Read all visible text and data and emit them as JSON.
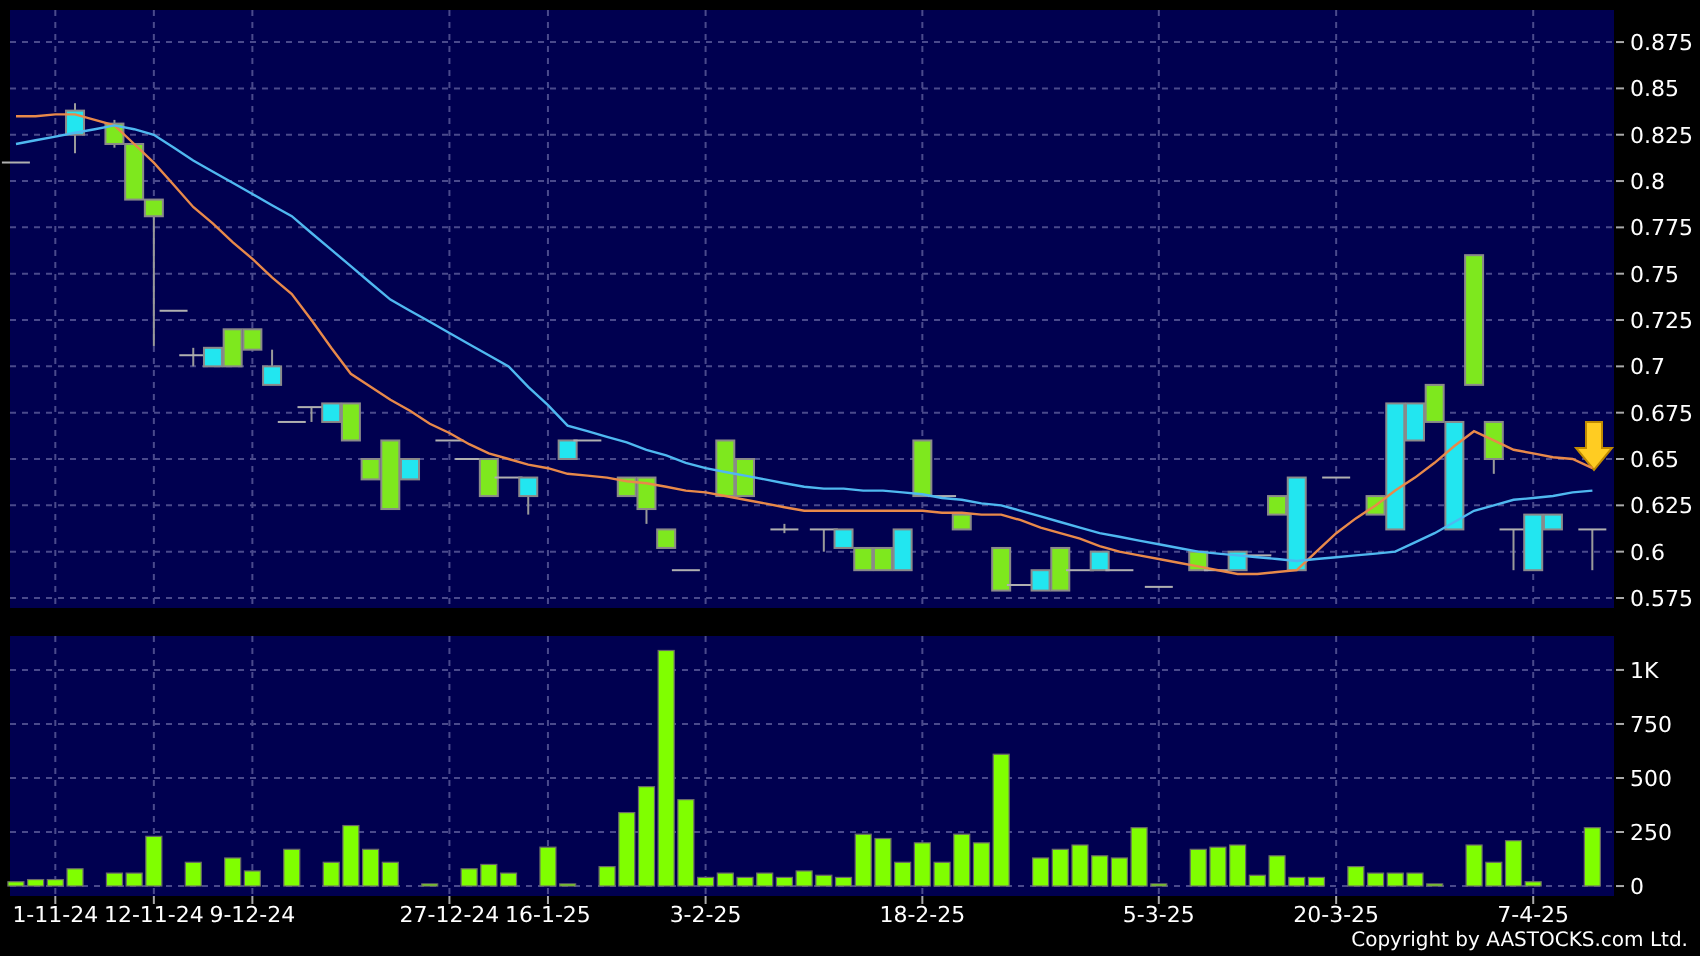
{
  "price_chart": {
    "chart_data": {
      "type": "line",
      "grid": true,
      "ylim": [
        0.5696,
        0.8923
      ],
      "yticks": [
        0.575,
        0.6,
        0.625,
        0.65,
        0.675,
        0.7,
        0.725,
        0.75,
        0.775,
        0.8,
        0.825,
        0.85,
        0.875
      ],
      "series": [
        {
          "color": "#e8894a",
          "values": [
            0.835,
            0.835,
            0.836,
            0.836,
            0.833,
            0.83,
            0.82,
            0.81,
            0.798,
            0.786,
            0.777,
            0.767,
            0.758,
            0.748,
            0.739,
            0.725,
            0.71,
            0.696,
            0.689,
            0.682,
            0.676,
            0.669,
            0.664,
            0.658,
            0.653,
            0.65,
            0.647,
            0.645,
            0.642,
            0.641,
            0.64,
            0.638,
            0.637,
            0.635,
            0.633,
            0.632,
            0.63,
            0.628,
            0.626,
            0.624,
            0.622,
            0.622,
            0.622,
            0.622,
            0.622,
            0.622,
            0.622,
            0.621,
            0.621,
            0.62,
            0.62,
            0.617,
            0.613,
            0.61,
            0.607,
            0.603,
            0.6,
            0.598,
            0.596,
            0.594,
            0.592,
            0.59,
            0.588,
            0.588,
            0.589,
            0.59,
            0.6,
            0.61,
            0.618,
            0.625,
            0.633,
            0.64,
            0.648,
            0.657,
            0.665,
            0.66,
            0.655,
            0.653,
            0.651,
            0.65,
            0.645
          ]
        },
        {
          "color": "#4fb8f0",
          "values": [
            0.82,
            0.822,
            0.824,
            0.826,
            0.828,
            0.83,
            0.828,
            0.825,
            0.818,
            0.811,
            0.805,
            0.799,
            0.793,
            0.787,
            0.781,
            0.772,
            0.763,
            0.754,
            0.745,
            0.736,
            0.73,
            0.724,
            0.718,
            0.712,
            0.706,
            0.7,
            0.689,
            0.679,
            0.668,
            0.665,
            0.662,
            0.659,
            0.655,
            0.652,
            0.648,
            0.645,
            0.643,
            0.641,
            0.639,
            0.637,
            0.635,
            0.634,
            0.634,
            0.633,
            0.633,
            0.632,
            0.631,
            0.629,
            0.628,
            0.626,
            0.625,
            0.622,
            0.619,
            0.616,
            0.613,
            0.61,
            0.608,
            0.606,
            0.604,
            0.602,
            0.6,
            0.599,
            0.598,
            0.597,
            0.596,
            0.595,
            0.596,
            0.597,
            0.598,
            0.599,
            0.6,
            0.605,
            0.61,
            0.616,
            0.622,
            0.625,
            0.628,
            0.629,
            0.63,
            0.632,
            0.633
          ]
        }
      ]
    }
  },
  "volume_chart": {
    "chart_data": {
      "type": "bar",
      "grid": true,
      "ylim": [
        -46,
        1157
      ],
      "categories": [
        null,
        null,
        "1-11-24",
        null,
        null,
        null,
        null,
        "12-11-24",
        null,
        null,
        null,
        null,
        "9-12-24",
        null,
        null,
        null,
        null,
        null,
        null,
        null,
        null,
        null,
        "27-12-24",
        null,
        null,
        null,
        null,
        "16-1-25",
        null,
        null,
        null,
        null,
        null,
        null,
        null,
        "3-2-25",
        null,
        null,
        null,
        null,
        null,
        null,
        null,
        null,
        null,
        null,
        "18-2-25",
        null,
        null,
        null,
        null,
        null,
        null,
        null,
        null,
        null,
        null,
        null,
        "5-3-25",
        null,
        null,
        null,
        null,
        null,
        null,
        null,
        null,
        "20-3-25",
        null,
        null,
        null,
        null,
        null,
        null,
        null,
        null,
        null,
        "7-4-25",
        null,
        null,
        null
      ],
      "yticks": [
        0,
        250,
        500,
        750,
        {
          "value": 1000,
          "label": "1K"
        }
      ],
      "values": [
        20,
        30,
        30,
        80,
        null,
        60,
        60,
        230,
        null,
        110,
        null,
        130,
        70,
        null,
        170,
        null,
        110,
        280,
        170,
        110,
        null,
        10,
        null,
        80,
        100,
        60,
        null,
        180,
        10,
        null,
        90,
        340,
        460,
        1090,
        400,
        40,
        60,
        40,
        60,
        40,
        70,
        50,
        40,
        240,
        220,
        110,
        200,
        110,
        240,
        200,
        610,
        null,
        130,
        170,
        190,
        140,
        130,
        270,
        10,
        null,
        170,
        180,
        190,
        50,
        140,
        40,
        40,
        null,
        90,
        60,
        60,
        60,
        10,
        null,
        190,
        110,
        210,
        20,
        null,
        null,
        270
      ]
    }
  },
  "copyright": "Copyright by AASTOCKS.com Ltd."
}
